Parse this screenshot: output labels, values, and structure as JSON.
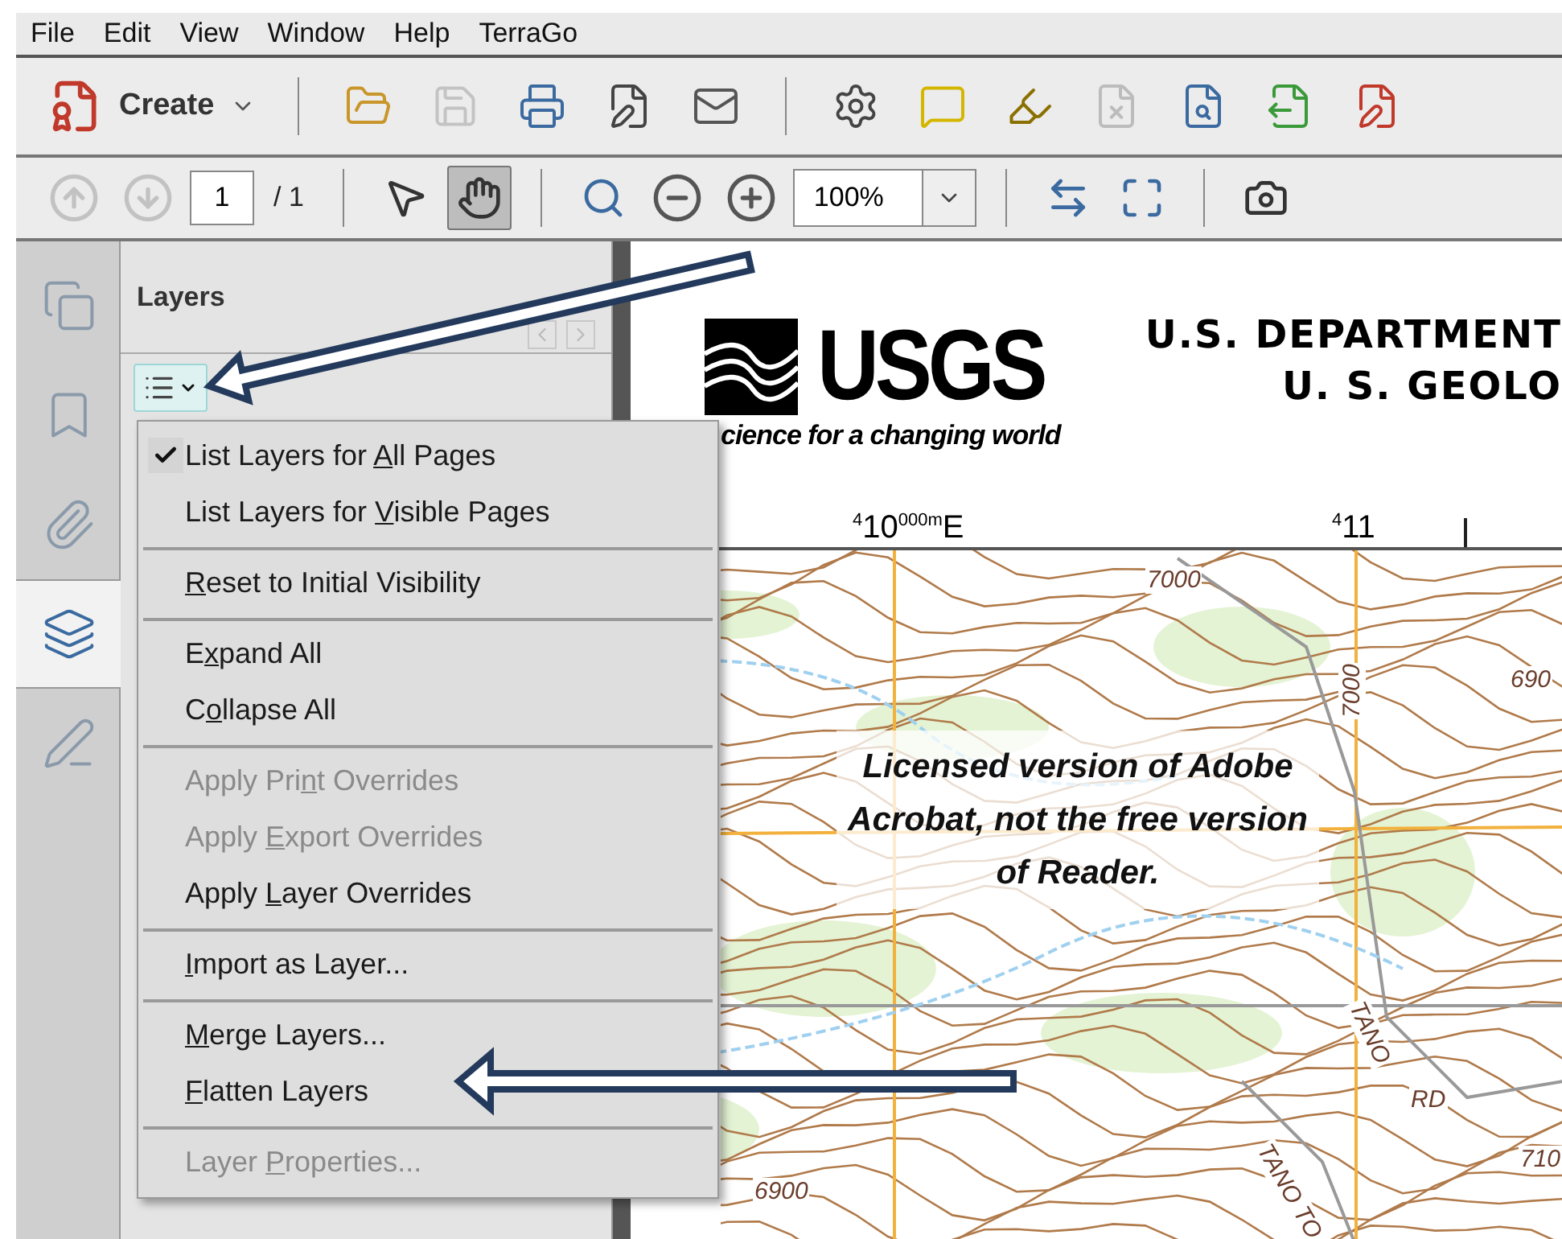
{
  "menubar": [
    {
      "label": "File"
    },
    {
      "label": "Edit"
    },
    {
      "label": "View"
    },
    {
      "label": "Window"
    },
    {
      "label": "Help"
    },
    {
      "label": "TerraGo"
    }
  ],
  "toolbar": {
    "create_label": "Create",
    "buttons": [
      {
        "disabled": false
      },
      {
        "disabled": true
      },
      {
        "disabled": false
      },
      {
        "disabled": false
      },
      {
        "disabled": false
      },
      {
        "disabled": false
      },
      {
        "disabled": false
      },
      {
        "disabled": false
      },
      {
        "disabled": true
      },
      {
        "disabled": false
      },
      {
        "disabled": false
      },
      {
        "disabled": false
      }
    ]
  },
  "navigation_toolbar": {
    "nav_buttons": [
      {
        "disabled": true
      },
      {
        "disabled": true
      }
    ],
    "page_number": "1",
    "page_total": "/ 1",
    "tools": [
      {
        "selected": false
      },
      {
        "selected": true
      }
    ],
    "zoom_value": "100%"
  },
  "navigation_pane": {
    "tabs": [
      {
        "selected": false
      },
      {
        "selected": false
      },
      {
        "selected": false
      },
      {
        "selected": true
      },
      {
        "selected": false
      }
    ]
  },
  "layers_panel": {
    "title": "Layers",
    "options_menu": [
      {
        "kind": "item",
        "before": "List Layers for ",
        "key": "A",
        "after": "ll Pages",
        "checked": true,
        "disabled": false
      },
      {
        "kind": "item",
        "before": "List Layers for ",
        "key": "V",
        "after": "isible Pages",
        "checked": false,
        "disabled": false
      },
      {
        "kind": "separator"
      },
      {
        "kind": "item",
        "key": "R",
        "after": "eset to Initial Visibility",
        "checked": false,
        "disabled": false
      },
      {
        "kind": "separator"
      },
      {
        "kind": "item",
        "before": "E",
        "key": "x",
        "after": "pand All",
        "checked": false,
        "disabled": false
      },
      {
        "kind": "item",
        "before": "C",
        "key": "o",
        "after": "llapse All",
        "checked": false,
        "disabled": false
      },
      {
        "kind": "separator"
      },
      {
        "kind": "item",
        "before": "Apply Pri",
        "key": "n",
        "after": "t Overrides",
        "checked": false,
        "disabled": true
      },
      {
        "kind": "item",
        "before": "Apply ",
        "key": "E",
        "after": "xport Overrides",
        "checked": false,
        "disabled": true
      },
      {
        "kind": "item",
        "before": "Apply ",
        "key": "L",
        "after": "ayer Overrides",
        "checked": false,
        "disabled": false
      },
      {
        "kind": "separator"
      },
      {
        "kind": "item",
        "key": "I",
        "after": "mport as Layer...",
        "checked": false,
        "disabled": false
      },
      {
        "kind": "separator"
      },
      {
        "kind": "item",
        "key": "M",
        "after": "erge Layers...",
        "checked": false,
        "disabled": false
      },
      {
        "kind": "item",
        "key": "F",
        "after": "latten Layers",
        "checked": false,
        "disabled": false
      },
      {
        "kind": "separator"
      },
      {
        "kind": "item",
        "before": "Layer ",
        "key": "P",
        "after": "roperties...",
        "checked": false,
        "disabled": true
      }
    ]
  },
  "document": {
    "logo_text": "USGS",
    "tagline": "cience for a changing world",
    "heading_1": "U.S. DEPARTMENT",
    "heading_2": "U. S. GEOLO",
    "grid_labels": [
      "$^{4}$10$^{000m}$E",
      "$^{4}$11"
    ],
    "map_labels": [
      {
        "text": "7000",
        "kind": "flat"
      },
      {
        "text": "7000",
        "kind": "vertical"
      },
      {
        "text": "690",
        "kind": "flat"
      },
      {
        "text": "6900",
        "kind": "flat"
      },
      {
        "text": "TANO",
        "kind": "slanted"
      },
      {
        "text": "RD",
        "kind": "flat"
      },
      {
        "text": "TANO TO",
        "kind": "slanted"
      },
      {
        "text": "710",
        "kind": "flat"
      }
    ],
    "caption": "Licensed version of Adobe Acrobat, not the free version of Reader."
  }
}
